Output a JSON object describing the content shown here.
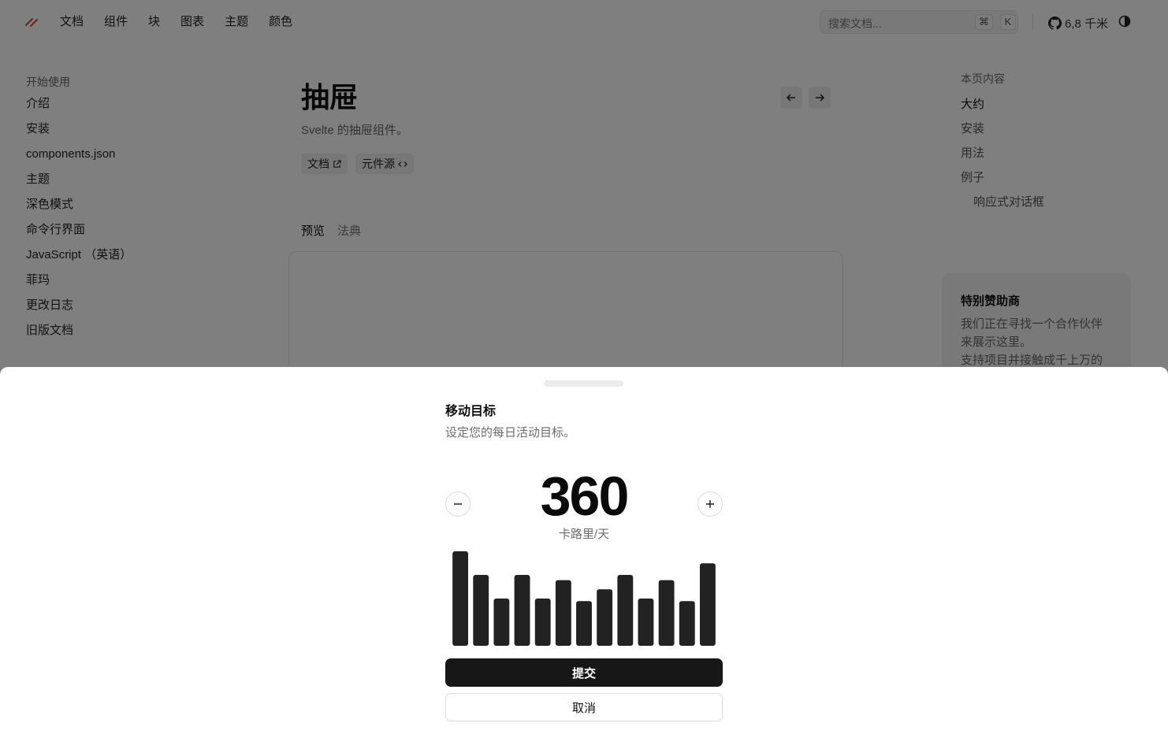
{
  "header": {
    "nav": [
      "文档",
      "组件",
      "块",
      "图表",
      "主题",
      "颜色"
    ],
    "search_placeholder": "搜索文档...",
    "kbd_cmd": "⌘",
    "kbd_k": "K",
    "github_stars": "6,8 千米"
  },
  "sidebar": {
    "group_title": "开始使用",
    "items": [
      "介绍",
      "安装",
      "components.json",
      "主题",
      "深色模式",
      "命令行界面",
      "JavaScript （英语）",
      "菲玛",
      "更改日志",
      "旧版文档"
    ]
  },
  "main": {
    "title": "抽屉",
    "subtitle": "Svelte 的抽屉组件。",
    "badge_docs": "文档",
    "badge_source": "元件源",
    "tab_preview": "预览",
    "tab_code": "法典"
  },
  "toc": {
    "title": "本页内容",
    "items": [
      "大约",
      "安装",
      "用法",
      "例子"
    ],
    "sub_item": "响应式对话框"
  },
  "sponsor": {
    "title": "特别赞助商",
    "body1": "我们正在寻找一个合作伙伴",
    "body2": "来展示这里。",
    "body3": "支持项目并接触成千上万的"
  },
  "drawer": {
    "title": "移动目标",
    "description": "设定您的每日活动目标。",
    "value": "360",
    "unit": "卡路里/天",
    "submit": "提交",
    "cancel": "取消",
    "bar_color": "#222222"
  },
  "chart_data": {
    "type": "bar",
    "values": [
      400,
      300,
      200,
      300,
      200,
      278,
      189,
      239,
      300,
      200,
      278,
      189,
      349
    ]
  }
}
